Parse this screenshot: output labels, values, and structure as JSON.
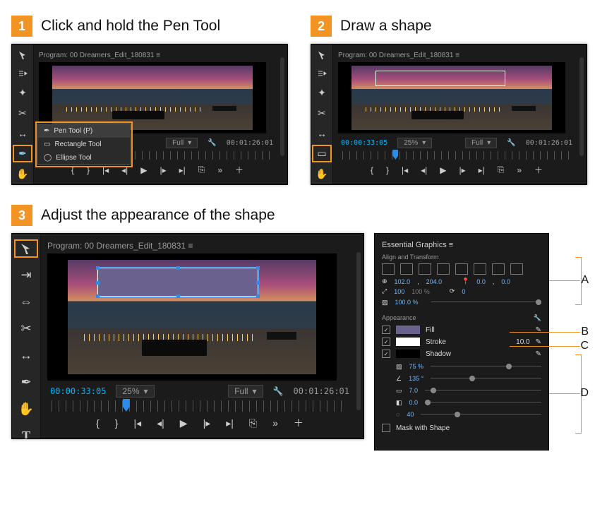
{
  "steps": {
    "s1": {
      "num": "1",
      "title": "Click and hold the Pen Tool"
    },
    "s2": {
      "num": "2",
      "title": "Draw a shape"
    },
    "s3": {
      "num": "3",
      "title": "Adjust the appearance of the shape"
    }
  },
  "program": {
    "title": "Program: 00 Dreamers_Edit_180831  ≡"
  },
  "flyout": {
    "pen": "Pen Tool (P)",
    "rect": "Rectangle Tool",
    "ellipse": "Ellipse Tool"
  },
  "status": {
    "tc": "00:00:33:05",
    "zoom": "25%",
    "fit": "Full",
    "dur": "00:01:26:01"
  },
  "eg": {
    "title": "Essential Graphics  ≡",
    "align": "Align and Transform",
    "posx": "102.0",
    "posy": "204.0",
    "ax": "0.0",
    "ay": "0.0",
    "scale": "100",
    "scale2": "100",
    "pct": "%",
    "rot": "0",
    "opacity": "100.0 %",
    "appearance": "Appearance",
    "fill": "Fill",
    "stroke": "Stroke",
    "strokew": "10.0",
    "shadow": "Shadow",
    "sh_op": "75 %",
    "sh_ang": "135 °",
    "sh_dist": "7.0",
    "sh_size": "0.0",
    "sh_blur": "40",
    "mask": "Mask with Shape"
  },
  "annot": {
    "A": "A",
    "B": "B",
    "C": "C",
    "D": "D"
  },
  "icons": {
    "select": "select-tool",
    "track": "track-select",
    "ripple": "ripple-edit",
    "razor": "razor-tool",
    "slip": "slip-tool",
    "pen": "pen-tool",
    "rect": "rectangle-tool",
    "hand": "hand-tool",
    "type": "type-tool",
    "wrench": "settings-icon",
    "menu": "hamburger-icon",
    "chev": "chevron-down-icon"
  }
}
